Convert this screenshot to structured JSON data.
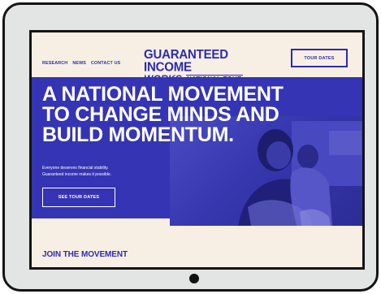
{
  "header": {
    "nav": [
      {
        "label": "RESEARCH"
      },
      {
        "label": "NEWS"
      },
      {
        "label": "CONTACT US"
      }
    ],
    "logo": {
      "line1": "GUARANTEED INCOME",
      "works": "WORKS",
      "tour": "NATIONAL TOUR"
    },
    "tour_button": "TOUR DATES"
  },
  "hero": {
    "headline": [
      "A NATIONAL MOVEMENT",
      "TO CHANGE MINDS AND",
      "BUILD MOMENTUM."
    ],
    "subtext": [
      "Everyone deserves financial stability.",
      "Guaranteed income makes it possible."
    ],
    "cta": "SEE TOUR DATES"
  },
  "section": {
    "title": "JOIN THE MOVEMENT"
  },
  "colors": {
    "brand_blue": "#3434b4",
    "background": "#f8efe4",
    "frame": "#e3e4e4"
  }
}
